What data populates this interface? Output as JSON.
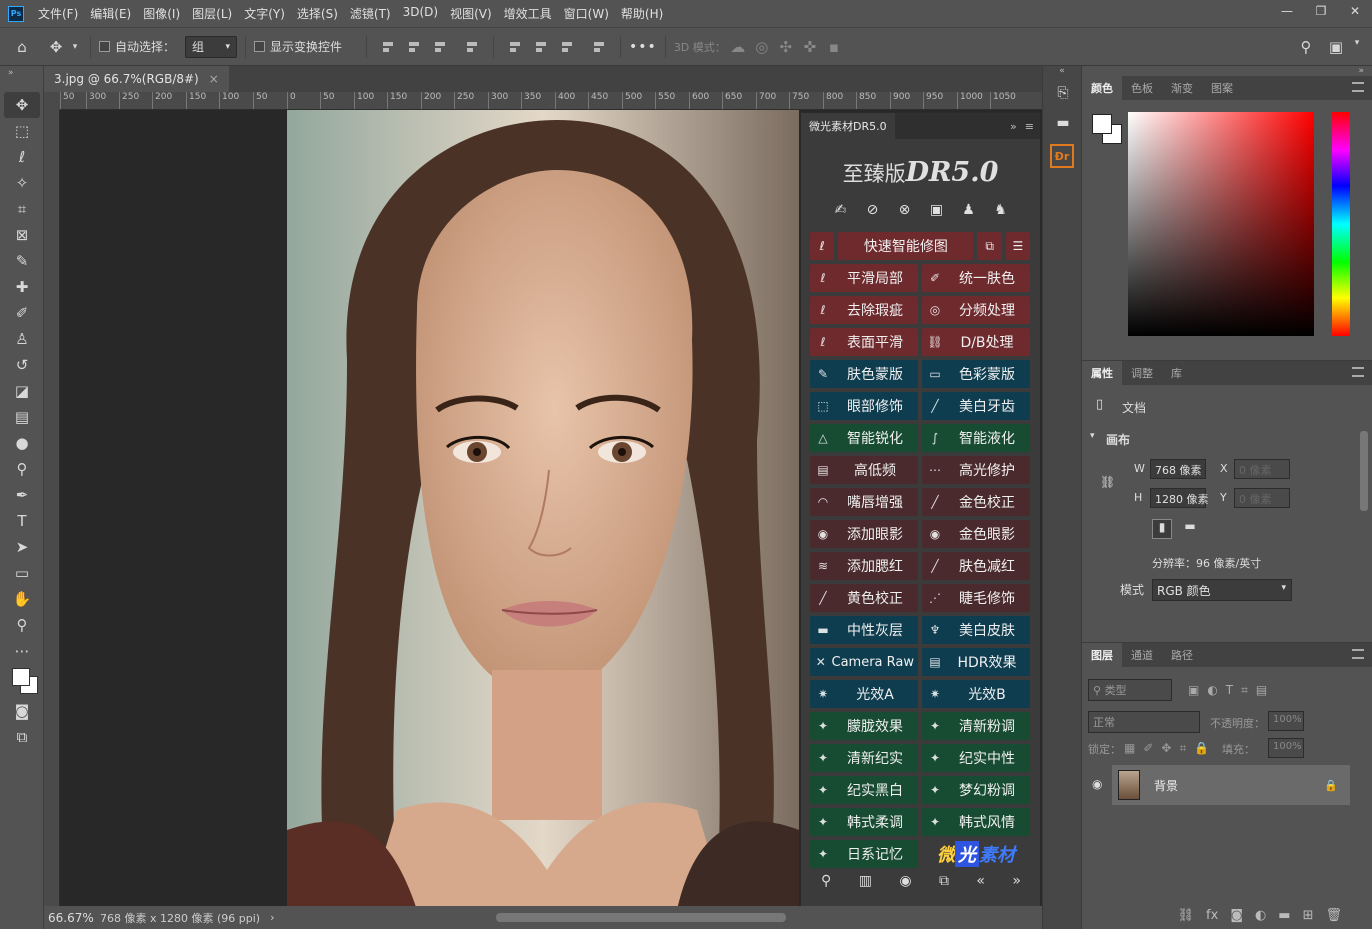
{
  "menubar": {
    "logo": "Ps",
    "items": [
      "文件(F)",
      "编辑(E)",
      "图像(I)",
      "图层(L)",
      "文字(Y)",
      "选择(S)",
      "滤镜(T)",
      "3D(D)",
      "视图(V)",
      "增效工具",
      "窗口(W)",
      "帮助(H)"
    ],
    "controls": [
      "—",
      "❐",
      "✕"
    ]
  },
  "optbar": {
    "auto_select_label": "自动选择：",
    "auto_select_value": "组",
    "show_transform_label": "显示变换控件",
    "more": "•••",
    "mode_3d_label": "3D 模式："
  },
  "doc_tab": {
    "title": "3.jpg @ 66.7%(RGB/8#)",
    "close": "×"
  },
  "ruler_top": [
    "50",
    "300",
    "250",
    "200",
    "150",
    "100",
    "50",
    "0",
    "50",
    "100",
    "150",
    "200",
    "250",
    "300",
    "350",
    "400",
    "450",
    "500",
    "550",
    "600",
    "650",
    "700",
    "750",
    "800",
    "850",
    "900",
    "950",
    "1000",
    "1050"
  ],
  "statusbar": {
    "zoom": "66.67%",
    "doc_size": "768 像素 x 1280 像素 (96 ppi)",
    "arrow": "›"
  },
  "plugin": {
    "tab": "微光素材DR5.0",
    "title_cn": "至臻版",
    "title_en": "DR5.0",
    "top_button": "快速智能修图",
    "rows": [
      [
        {
          "label": "平滑局部",
          "icon": "lasso-icon",
          "c": "red"
        },
        {
          "label": "统一肤色",
          "icon": "brush-icon",
          "c": "red"
        }
      ],
      [
        {
          "label": "去除瑕疵",
          "icon": "lasso-icon",
          "c": "red"
        },
        {
          "label": "分频处理",
          "icon": "circle-icon",
          "c": "red"
        }
      ],
      [
        {
          "label": "表面平滑",
          "icon": "lasso-icon",
          "c": "red"
        },
        {
          "label": "D/B处理",
          "icon": "link-icon",
          "c": "red"
        }
      ],
      [
        {
          "label": "肤色蒙版",
          "icon": "dropper-icon",
          "c": "blue"
        },
        {
          "label": "色彩蒙版",
          "icon": "rect-icon",
          "c": "blue"
        }
      ],
      [
        {
          "label": "眼部修饰",
          "icon": "marquee-icon",
          "c": "blue"
        },
        {
          "label": "美白牙齿",
          "icon": "pen-icon",
          "c": "blue"
        }
      ],
      [
        {
          "label": "智能锐化",
          "icon": "triangle-icon",
          "c": "green"
        },
        {
          "label": "智能液化",
          "icon": "curve-icon",
          "c": "green"
        }
      ],
      [
        {
          "label": "高低频",
          "icon": "frame-icon",
          "c": "gray"
        },
        {
          "label": "高光修护",
          "icon": "dots-icon",
          "c": "gray"
        }
      ],
      [
        {
          "label": "嘴唇增强",
          "icon": "lips-icon",
          "c": "gray"
        },
        {
          "label": "金色校正",
          "icon": "pen-icon",
          "c": "gray"
        }
      ],
      [
        {
          "label": "添加眼影",
          "icon": "eye-icon",
          "c": "gray"
        },
        {
          "label": "金色眼影",
          "icon": "eye-icon",
          "c": "gray"
        }
      ],
      [
        {
          "label": "添加腮红",
          "icon": "blush-icon",
          "c": "gray"
        },
        {
          "label": "肤色减红",
          "icon": "pen-icon",
          "c": "gray"
        }
      ],
      [
        {
          "label": "黄色校正",
          "icon": "pen-icon",
          "c": "gray"
        },
        {
          "label": "睫毛修饰",
          "icon": "lash-icon",
          "c": "gray"
        }
      ],
      [
        {
          "label": "中性灰层",
          "icon": "layer-icon",
          "c": "blue"
        },
        {
          "label": "美白皮肤",
          "icon": "tube-icon",
          "c": "blue"
        }
      ],
      [
        {
          "label": "Camera Raw",
          "icon": "close-icon",
          "c": "blue"
        },
        {
          "label": "HDR效果",
          "icon": "frame-icon",
          "c": "blue"
        }
      ],
      [
        {
          "label": "光效A",
          "icon": "sun-icon",
          "c": "blue"
        },
        {
          "label": "光效B",
          "icon": "sun-icon",
          "c": "blue"
        }
      ],
      [
        {
          "label": "朦胧效果",
          "icon": "wand-icon",
          "c": "green"
        },
        {
          "label": "清新粉调",
          "icon": "wand-icon",
          "c": "green"
        }
      ],
      [
        {
          "label": "清新纪实",
          "icon": "wand-icon",
          "c": "green"
        },
        {
          "label": "纪实中性",
          "icon": "wand-icon",
          "c": "green"
        }
      ],
      [
        {
          "label": "纪实黑白",
          "icon": "wand-icon",
          "c": "green"
        },
        {
          "label": "梦幻粉调",
          "icon": "wand-icon",
          "c": "green"
        }
      ],
      [
        {
          "label": "韩式柔调",
          "icon": "wand-icon",
          "c": "green"
        },
        {
          "label": "韩式风情",
          "icon": "wand-icon",
          "c": "green"
        }
      ]
    ],
    "last_button": "日系记忆",
    "logo": {
      "a": "微",
      "b": "光",
      "c": "素材"
    }
  },
  "color_panel": {
    "tabs": [
      "颜色",
      "色板",
      "渐变",
      "图案"
    ]
  },
  "props_panel": {
    "tabs": [
      "属性",
      "调整",
      "库"
    ],
    "doc_label": "文档",
    "section": "画布",
    "w_label": "W",
    "w_value": "768 像素",
    "h_label": "H",
    "h_value": "1280 像素",
    "x_label": "X",
    "x_value": "0 像素",
    "y_label": "Y",
    "y_value": "0 像素",
    "resolution": "分辨率：96 像素/英寸",
    "mode_label": "模式",
    "mode_value": "RGB 颜色"
  },
  "layers_panel": {
    "tabs": [
      "图层",
      "通道",
      "路径"
    ],
    "filter_kind": "类型",
    "blend_mode": "正常",
    "opacity_label": "不透明度：",
    "opacity_value": "100%",
    "lock_label": "锁定：",
    "fill_label": "填充：",
    "fill_value": "100%",
    "layer_name": "背景"
  }
}
